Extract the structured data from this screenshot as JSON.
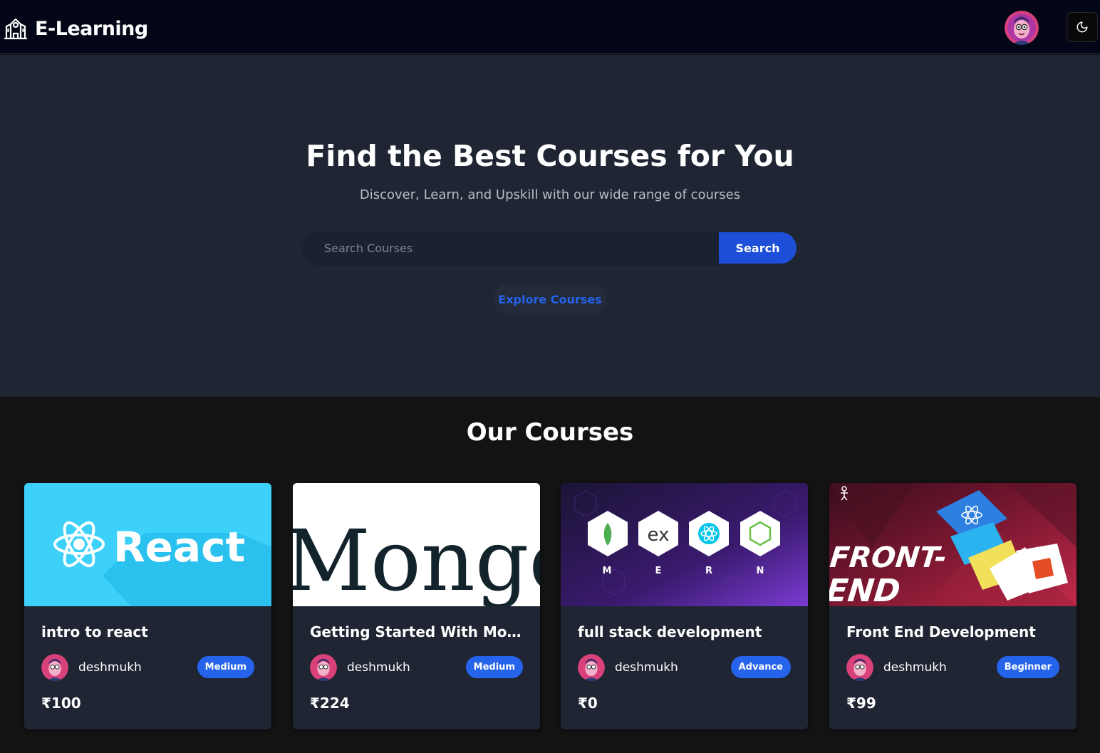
{
  "navbar": {
    "brand": "E-Learning",
    "brand_icon": "school-icon",
    "avatar_icon": "user-avatar",
    "theme_icon": "moon-icon"
  },
  "hero": {
    "title": "Find the Best Courses for You",
    "subtitle": "Discover, Learn, and Upskill with our wide range of courses",
    "search_placeholder": "Search Courses",
    "search_label": "Search",
    "explore_label": "Explore Courses"
  },
  "courses": {
    "heading": "Our Courses",
    "items": [
      {
        "title": "intro to react",
        "author": "deshmukh",
        "level": "Medium",
        "price": "₹100",
        "image_text": "React"
      },
      {
        "title": "Getting Started With Mong...",
        "author": "deshmukh",
        "level": "Medium",
        "price": "₹224",
        "image_text": "Mongo"
      },
      {
        "title": "full stack development",
        "author": "deshmukh",
        "level": "Advance",
        "price": "₹0",
        "image_letters": [
          "M",
          "E",
          "R",
          "N"
        ],
        "image_text": "ex"
      },
      {
        "title": "Front End Development",
        "author": "deshmukh",
        "level": "Beginner",
        "price": "₹99",
        "image_text": [
          "FRONT-",
          "END"
        ]
      }
    ]
  },
  "colors": {
    "navbar_bg": "#020617",
    "hero_bg": "#1f2533",
    "page_bg": "#131313",
    "card_bg": "#1f2533",
    "accent": "#2563eb"
  }
}
